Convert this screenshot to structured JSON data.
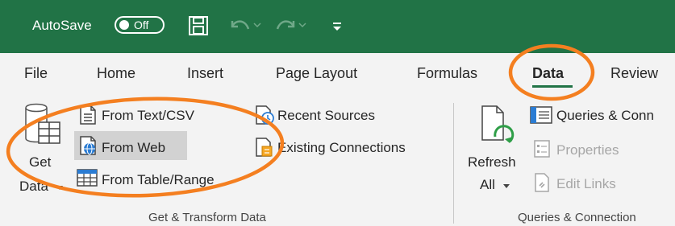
{
  "titlebar": {
    "autosave_label": "AutoSave",
    "autosave_state": "Off",
    "icons": [
      "save-icon",
      "undo-icon",
      "redo-icon",
      "customize-qat-icon"
    ],
    "bg_color": "#217346"
  },
  "tabs": [
    {
      "label": "File"
    },
    {
      "label": "Home"
    },
    {
      "label": "Insert"
    },
    {
      "label": "Page Layout"
    },
    {
      "label": "Formulas"
    },
    {
      "label": "Data",
      "active": true
    },
    {
      "label": "Review"
    }
  ],
  "get_transform": {
    "get_data_line1": "Get",
    "get_data_line2": "Data",
    "from_text_csv": "From Text/CSV",
    "from_web": "From Web",
    "from_table_range": "From Table/Range",
    "recent_sources": "Recent Sources",
    "existing_connections": "Existing Connections",
    "group_label": "Get & Transform Data"
  },
  "queries": {
    "refresh_line1": "Refresh",
    "refresh_line2": "All",
    "queries_connections": "Queries & Conn",
    "properties": "Properties",
    "edit_links": "Edit Links",
    "group_label": "Queries & Connection"
  },
  "annotation_color": "#f47f20"
}
